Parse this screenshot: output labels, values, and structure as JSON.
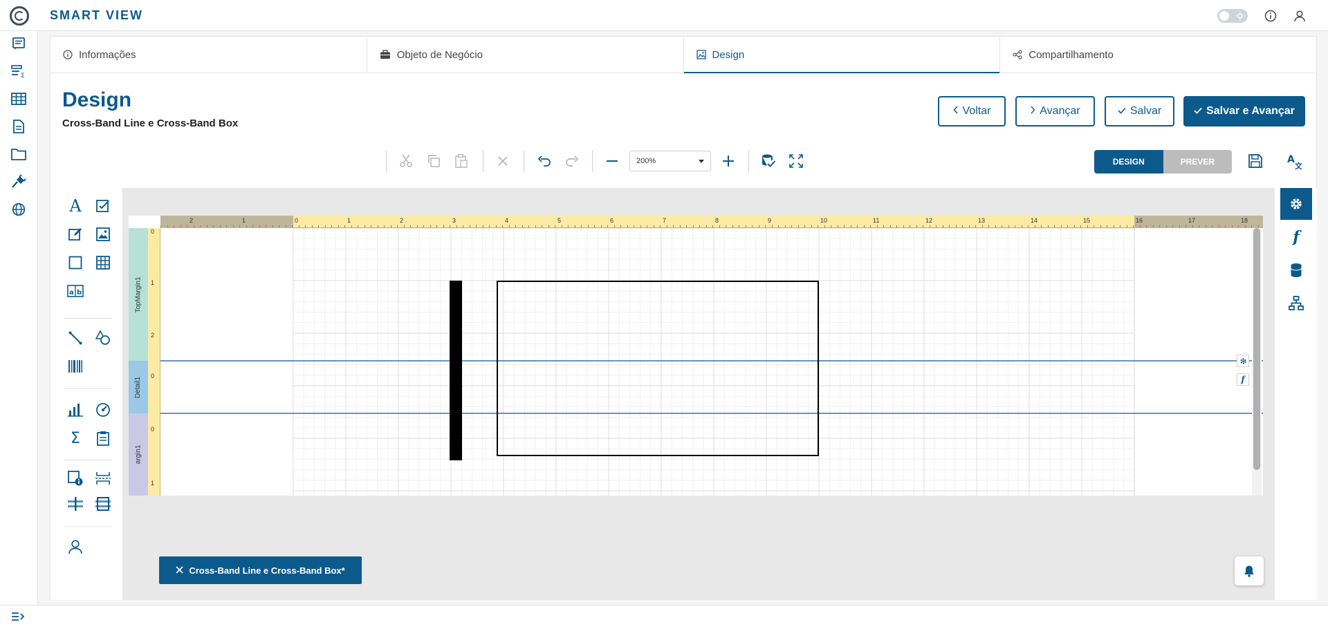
{
  "app": {
    "title": "SMART VIEW"
  },
  "tabs": [
    {
      "label": "Informações",
      "icon": "info-icon"
    },
    {
      "label": "Objeto de Negócio",
      "icon": "briefcase-icon"
    },
    {
      "label": "Design",
      "icon": "image-icon",
      "active": true
    },
    {
      "label": "Compartilhamento",
      "icon": "share-icon"
    }
  ],
  "page": {
    "title": "Design",
    "subtitle": "Cross-Band Line e Cross-Band Box"
  },
  "actions": {
    "back": "Voltar",
    "next": "Avançar",
    "save": "Salvar",
    "save_next": "Salvar e Avançar"
  },
  "toolbar": {
    "zoom": "200%",
    "mode_design": "DESIGN",
    "mode_preview": "PREVER"
  },
  "designer": {
    "bands": [
      "TopMargin1",
      "Detail1",
      "argin1"
    ],
    "ruler_h_left": [
      "2",
      "1",
      "0"
    ],
    "ruler_h": [
      "1",
      "2",
      "3",
      "4",
      "5",
      "6",
      "7",
      "8",
      "9",
      "10",
      "11",
      "12",
      "13",
      "14",
      "15",
      "16",
      "17",
      "18"
    ],
    "ruler_v": [
      "0",
      "1",
      "2",
      "0",
      "0",
      "1"
    ]
  },
  "document_tab": {
    "label": "Cross-Band Line e Cross-Band Box*"
  },
  "colors": {
    "primary": "#0c5a8c",
    "ruler": "#fdeaa5",
    "band_top": "#b5e1d7",
    "band_detail": "#99c9e6",
    "band_bottom": "#c9c9e6"
  }
}
